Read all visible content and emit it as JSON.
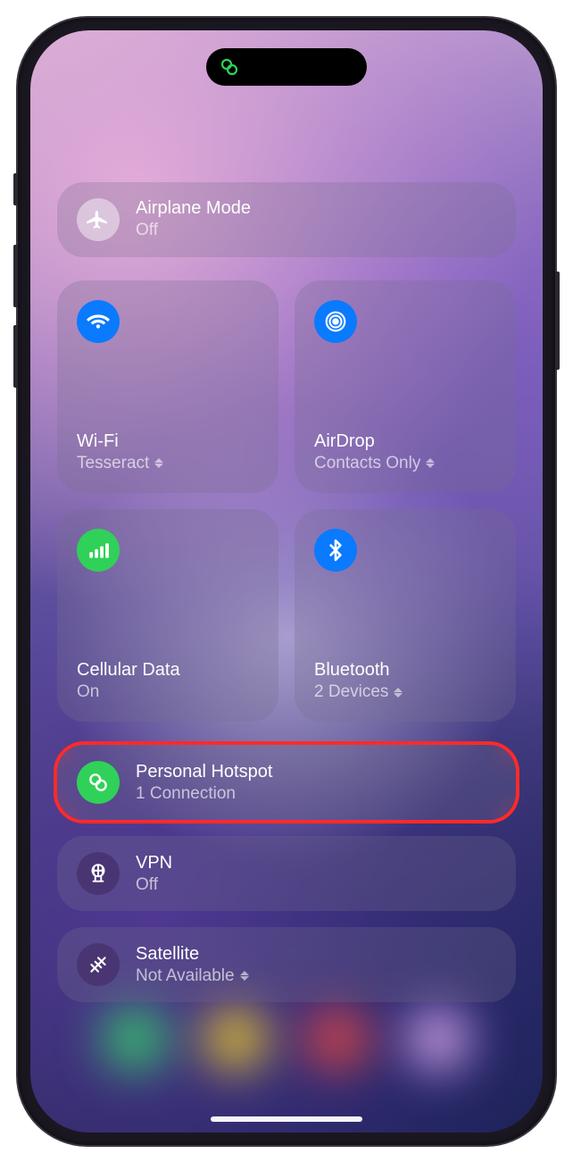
{
  "statusIndicator": {
    "icon": "hotspot-active"
  },
  "tiles": {
    "airplane": {
      "title": "Airplane Mode",
      "subtitle": "Off"
    },
    "wifi": {
      "title": "Wi-Fi",
      "subtitle": "Tesseract"
    },
    "airdrop": {
      "title": "AirDrop",
      "subtitle": "Contacts Only"
    },
    "cellular": {
      "title": "Cellular Data",
      "subtitle": "On"
    },
    "bluetooth": {
      "title": "Bluetooth",
      "subtitle": "2 Devices"
    },
    "hotspot": {
      "title": "Personal Hotspot",
      "subtitle": "1 Connection"
    },
    "vpn": {
      "title": "VPN",
      "subtitle": "Off"
    },
    "satellite": {
      "title": "Satellite",
      "subtitle": "Not Available"
    }
  },
  "colors": {
    "blue": "#0a7aff",
    "green": "#30d158",
    "highlight": "#ff2a2a"
  }
}
